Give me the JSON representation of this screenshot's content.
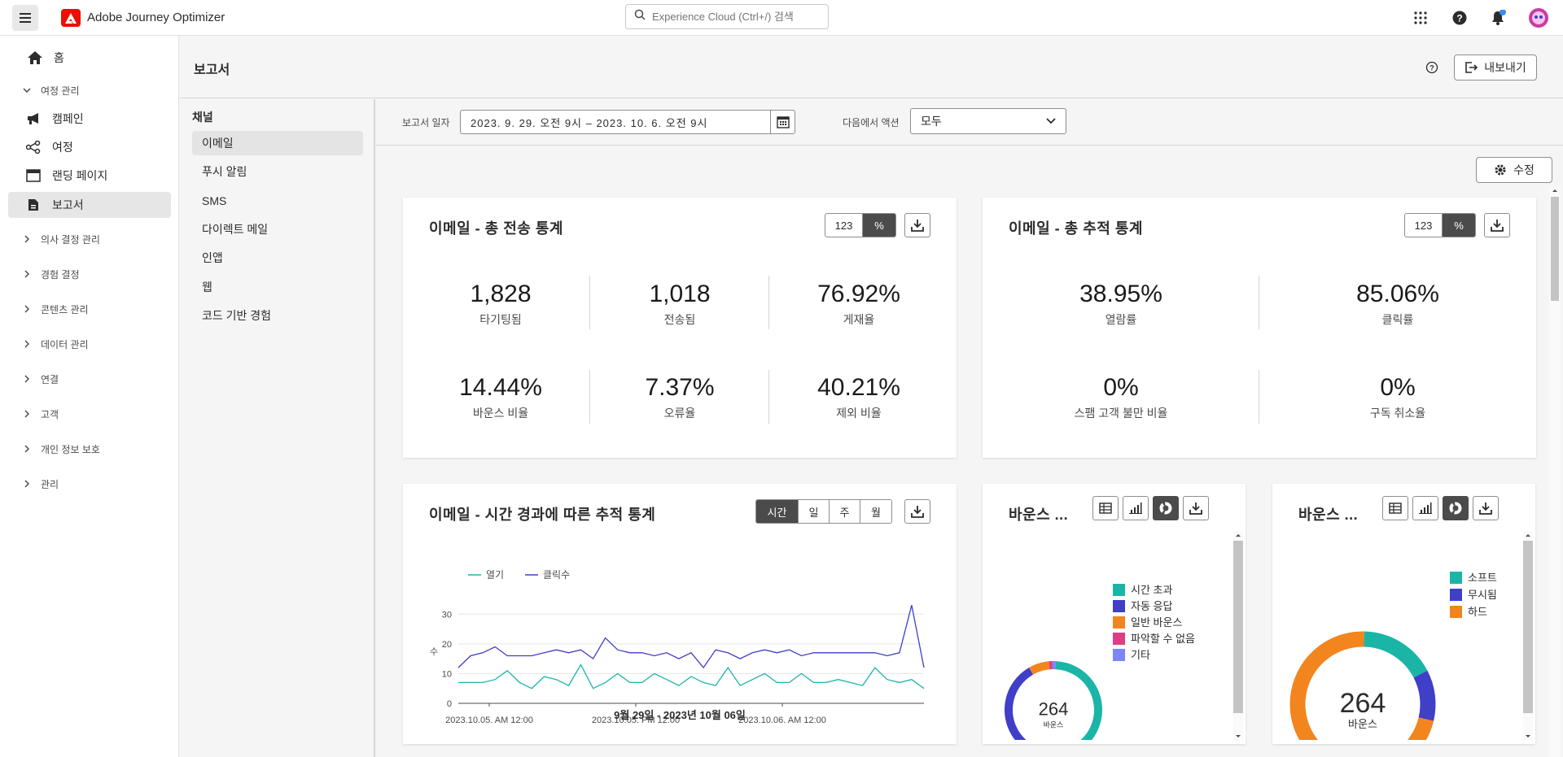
{
  "app": {
    "title": "Adobe Journey Optimizer",
    "search_placeholder": "Experience Cloud (Ctrl+/) 검색"
  },
  "sidebar": {
    "home": "홈",
    "journey_group": "여정 관리",
    "items": [
      {
        "label": "캠페인",
        "icon": "megaphone-icon"
      },
      {
        "label": "여정",
        "icon": "journey-icon"
      },
      {
        "label": "랜딩 페이지",
        "icon": "landing-page-icon"
      },
      {
        "label": "보고서",
        "icon": "report-icon"
      }
    ],
    "groups": [
      "의사 결정 관리",
      "경험 결정",
      "콘텐츠 관리",
      "데이터 관리",
      "연결",
      "고객",
      "개인 정보 보호",
      "관리"
    ]
  },
  "header": {
    "title": "보고서",
    "export": "내보내기"
  },
  "channels": {
    "title": "채널",
    "items": [
      "이메일",
      "푸시 알림",
      "SMS",
      "다이렉트 메일",
      "인앱",
      "웹",
      "코드 기반 경험"
    ]
  },
  "filters": {
    "date_label": "보고서 일자",
    "date_value": "2023. 9. 29. 오전 9시 – 2023. 10. 6. 오전 9시",
    "action_label": "다음에서 액션",
    "action_value": "모두"
  },
  "edit_button": "수정",
  "toggle": {
    "num": "123",
    "pct": "%"
  },
  "card_sent": {
    "title": "이메일 - 총 전송 통계",
    "metrics": [
      {
        "value": "1,828",
        "label": "타기팅됨"
      },
      {
        "value": "1,018",
        "label": "전송됨"
      },
      {
        "value": "76.92%",
        "label": "게재율"
      },
      {
        "value": "14.44%",
        "label": "바운스 비율"
      },
      {
        "value": "7.37%",
        "label": "오류율"
      },
      {
        "value": "40.21%",
        "label": "제외 비율"
      }
    ]
  },
  "card_track": {
    "title": "이메일 - 총 추적 통계",
    "metrics": [
      {
        "value": "38.95%",
        "label": "열람률"
      },
      {
        "value": "85.06%",
        "label": "클릭률"
      },
      {
        "value": "0%",
        "label": "스팸 고객 불만 비율"
      },
      {
        "value": "0%",
        "label": "구독 취소율"
      }
    ]
  },
  "card_time": {
    "title": "이메일 - 시간 경과에 따른 추적 통계",
    "granularity": [
      "시간",
      "일",
      "주",
      "월"
    ],
    "y_axis_glyph": "수",
    "footer": "9월 29일 - 2023년 10월 06일"
  },
  "chart_data": [
    {
      "type": "line",
      "x_ticks": [
        "2023.10.05. AM 12:00",
        "2023.10.05. PM 12:00",
        "2023.10.06. AM 12:00"
      ],
      "ylim": [
        0,
        35
      ],
      "y_ticks": [
        0,
        10,
        20,
        30
      ],
      "series": [
        {
          "name": "열기",
          "color": "#1bb5a8",
          "values": [
            7,
            7,
            7,
            8,
            11,
            7,
            5,
            9,
            8,
            6,
            13,
            5,
            7,
            10,
            7,
            7,
            10,
            8,
            6,
            9,
            7,
            6,
            12,
            6,
            8,
            10,
            7,
            7,
            10,
            7,
            7,
            8,
            7,
            6,
            12,
            8,
            7,
            8,
            5
          ]
        },
        {
          "name": "클릭수",
          "color": "#3f3fc7",
          "values": [
            12,
            16,
            17,
            19,
            16,
            16,
            16,
            17,
            18,
            17,
            18,
            15,
            22,
            18,
            17,
            17,
            16,
            17,
            15,
            17,
            12,
            18,
            17,
            15,
            17,
            18,
            17,
            18,
            16,
            17,
            17,
            17,
            17,
            17,
            17,
            16,
            17,
            33,
            12
          ]
        }
      ]
    },
    {
      "type": "pie",
      "title": "바운스 ...",
      "center_value": "264",
      "center_label": "바운스",
      "slices": [
        {
          "label": "시간 초과",
          "value": 160,
          "color": "#1bb5a8"
        },
        {
          "label": "자동 응답",
          "value": 80,
          "color": "#3f3fc7"
        },
        {
          "label": "일반 바운스",
          "value": 18,
          "color": "#f2851d"
        },
        {
          "label": "파악할 수 없음",
          "value": 3,
          "color": "#de3d82"
        },
        {
          "label": "기타",
          "value": 3,
          "color": "#7e84fa"
        }
      ]
    },
    {
      "type": "pie",
      "title": "바운스 ...",
      "center_value": "264",
      "center_label": "바운스",
      "slices": [
        {
          "label": "소프트",
          "value": 45,
          "color": "#1bb5a8"
        },
        {
          "label": "무시됨",
          "value": 30,
          "color": "#3f3fc7"
        },
        {
          "label": "하드",
          "value": 189,
          "color": "#f2851d"
        }
      ]
    }
  ]
}
